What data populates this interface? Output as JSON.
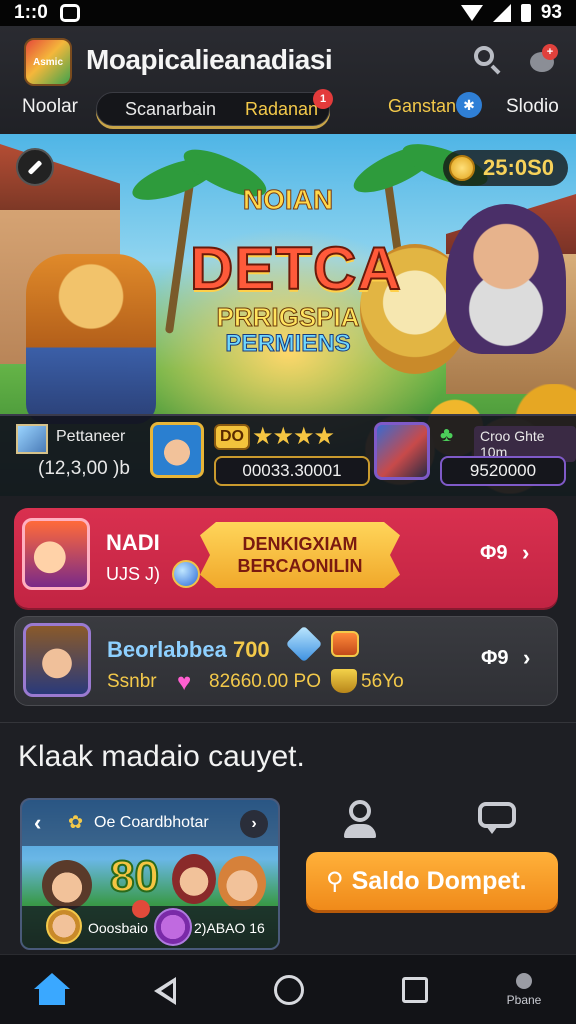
{
  "status_bar": {
    "time": "1::0",
    "battery": "93"
  },
  "header": {
    "title": "Moapicalieanadiasi",
    "logo_text": "Asmic",
    "notification_badge": "+"
  },
  "tabs": {
    "left": "Noolar",
    "segment_left": "Scanarbain",
    "segment_right": "Radanan",
    "segment_badge": "1",
    "games": "Ganstan",
    "games_icon": "✱",
    "right": "Slodio"
  },
  "hero": {
    "coins": "25:0S0",
    "line1": "NOIAN",
    "line2": "DETCA",
    "line3": "PRRIGSPIA",
    "line4": "PERMIENS"
  },
  "stats": {
    "player_label": "Pettaneer",
    "player_value": "(12,3,00 )b",
    "badge": "DO",
    "stars": "★★★★",
    "middle_value": "00033.30001",
    "right_label": "Croo Ghte 10m",
    "right_value": "9520000"
  },
  "offer_red": {
    "name": "NADI",
    "sub": "UJS J)",
    "banner_line1": "DENKIGXIAM",
    "banner_line2": "BERCAONILIN",
    "price": "Φ9"
  },
  "offer_gray": {
    "title": "Beorlabbea",
    "title_num": "700",
    "sub": "Ssnbr",
    "amount": "82660.00 PO",
    "amount2": "56Yo",
    "price": "Φ9"
  },
  "section": {
    "title": "Klaak madaio cauyet."
  },
  "mini_card": {
    "title": "Oe Coardbhotar",
    "big_number": "80",
    "bottom_left": "Ooosbaio",
    "bottom_right": "2)ABAO 16"
  },
  "cta": {
    "label": "Saldo Dompet."
  },
  "nav": {
    "profile_label": "Pbane"
  },
  "colors": {
    "accent_orange": "#f08a1a",
    "card_red": "#c22443",
    "gold": "#f3c94a",
    "nav_active": "#3aa8ff"
  }
}
